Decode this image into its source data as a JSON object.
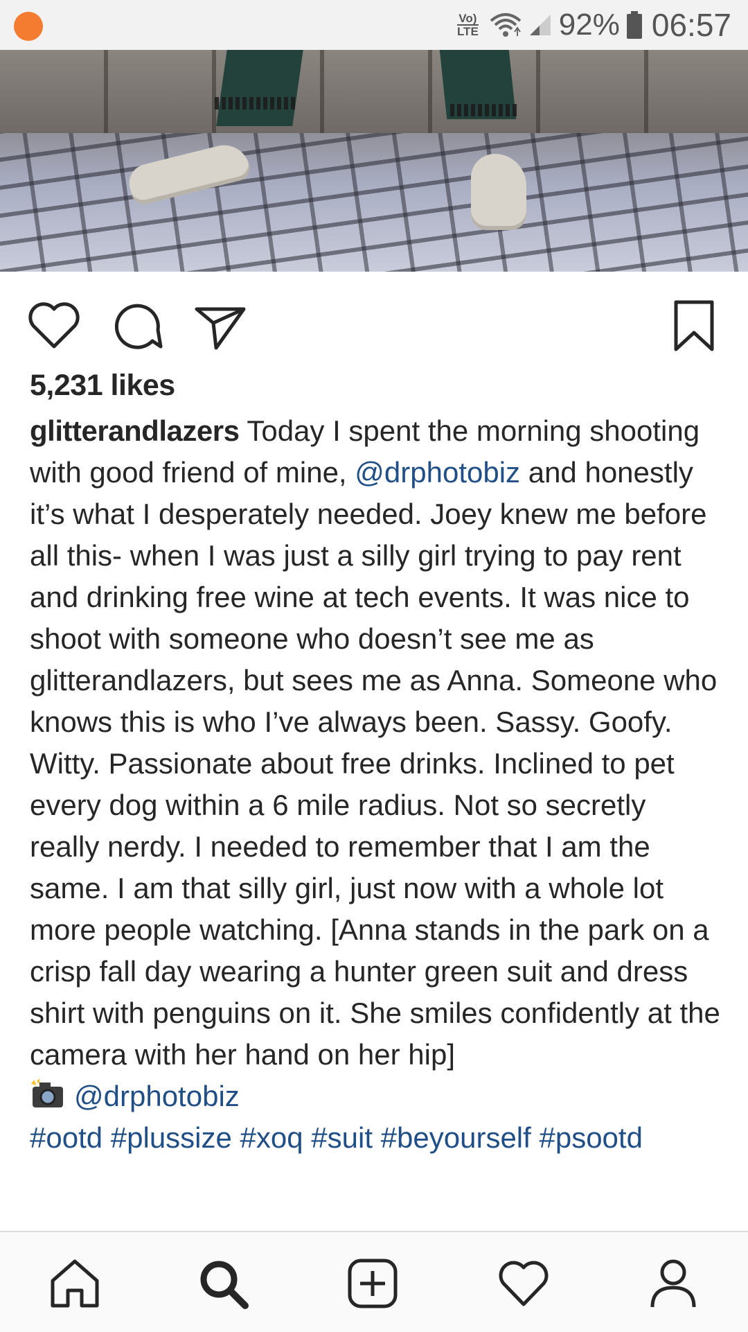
{
  "status_bar": {
    "volte_top": "Vo)",
    "volte_bottom": "LTE",
    "battery": "92%",
    "time": "06:57"
  },
  "post": {
    "likes": "5,231 likes",
    "username": "glitterandlazers",
    "caption_part1": " Today I spent the morning shooting with good friend of mine, ",
    "mention": "@drphotobiz",
    "caption_part2": " and honestly it’s what I desperately needed. Joey knew me before all this- when I was just a silly girl trying to pay rent and drinking free wine at tech events. It was nice to shoot with someone who doesn’t see me as glitterandlazers, but sees me as Anna. Someone who knows this is who I’ve always been. Sassy. Goofy. Witty. Passionate about free drinks. Inclined to pet every dog within a 6 mile radius. Not so secretly really nerdy. I needed to remember that I am the same. I am that silly girl, just now with a whole lot more people watching. [Anna stands in the park on a crisp fall day wearing a hunter green suit and dress shirt with penguins on it. She smiles confidently at the camera with her hand on her hip]",
    "photo_credit_mention": "@drphotobiz",
    "hashtags": "#ootd #plussize #xoq #suit #beyourself #psootd"
  },
  "icons": {
    "like": "heart-icon",
    "comment": "comment-bubble-icon",
    "share": "paper-plane-icon",
    "save": "bookmark-icon",
    "nav": [
      "home-icon",
      "search-icon",
      "add-post-icon",
      "activity-heart-icon",
      "profile-icon"
    ]
  },
  "colors": {
    "mention_link": "#1f4f86",
    "notification_dot": "#f47c30",
    "text": "#262626"
  }
}
